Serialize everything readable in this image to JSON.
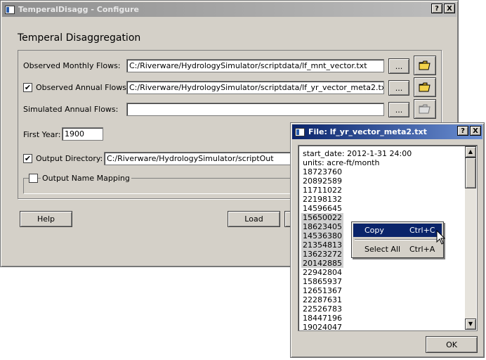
{
  "main_window": {
    "title": "TemperalDisagg - Configure",
    "heading": "Temperal Disaggregation",
    "rows": {
      "observed_monthly": {
        "label": "Observed Monthly Flows:",
        "value": "C:/Riverware/HydrologySimulator/scriptdata/lf_mnt_vector.txt"
      },
      "observed_annual": {
        "label": "Observed Annual Flows:",
        "checked": true,
        "value": "C:/Riverware/HydrologySimulator/scriptdata/lf_yr_vector_meta2.txt"
      },
      "simulated_annual": {
        "label": "Simulated Annual Flows:",
        "value": ""
      },
      "first_year": {
        "label": "First Year:",
        "value": "1900"
      },
      "output_directory": {
        "label": "Output Directory:",
        "checked": true,
        "value": "C:/Riverware/HydrologySimulator/scriptOut"
      },
      "output_name_mapping": {
        "label": "Output Name Mapping",
        "checked": false
      }
    },
    "browse_label": "...",
    "check_mark": "✔",
    "help_label": "Help",
    "load_label": "Load",
    "title_buttons": {
      "help": "?",
      "close": "X"
    }
  },
  "file_dialog": {
    "title": "File: lf_yr_vector_meta2.txt",
    "lines": [
      "start_date: 2012-1-31 24:00",
      "units: acre-ft/month",
      "18723760",
      "20892589",
      "11711022",
      "22198132",
      "14596645",
      "15650022",
      "18623405",
      "14536380",
      "21354813",
      "13623272",
      "20142885",
      "22942804",
      "15865937",
      "12651367",
      "22287631",
      "22526783",
      "18447196",
      "19024047"
    ],
    "selected_line_indices": [
      7,
      8,
      9,
      10,
      11,
      12
    ],
    "ok_label": "OK",
    "title_buttons": {
      "help": "?",
      "close": "X"
    },
    "scroll_up": "▲",
    "scroll_down": "▼"
  },
  "context_menu": {
    "items": [
      {
        "label": "Copy",
        "shortcut": "Ctrl+C",
        "highlighted": true
      },
      {
        "label": "Select All",
        "shortcut": "Ctrl+A",
        "highlighted": false
      }
    ]
  }
}
